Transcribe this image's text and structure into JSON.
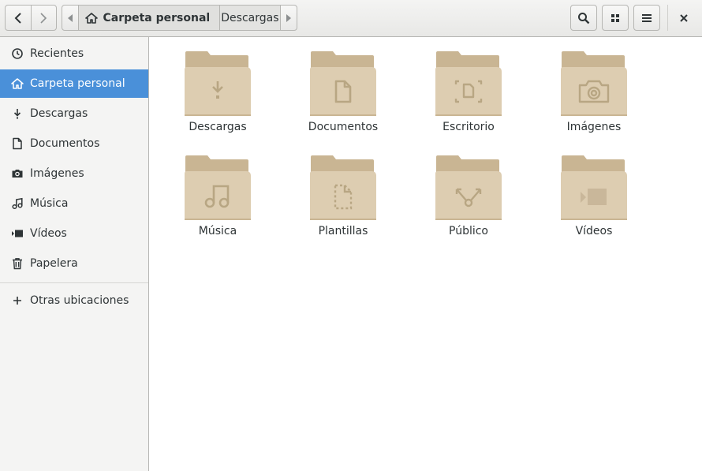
{
  "header": {
    "back_icon": "go-previous-icon",
    "forward_icon": "go-next-icon",
    "path": {
      "home_icon": "home-icon",
      "current": "Carpeta personal",
      "child": "Descargas"
    },
    "search_icon": "search-icon",
    "grid_view_icon": "view-grid-icon",
    "menu_icon": "open-menu-icon",
    "close_icon": "close-icon"
  },
  "sidebar": {
    "items": [
      {
        "label": "Recientes",
        "icon": "clock-icon"
      },
      {
        "label": "Carpeta personal",
        "icon": "home-icon",
        "selected": true
      },
      {
        "label": "Descargas",
        "icon": "download-icon"
      },
      {
        "label": "Documentos",
        "icon": "document-icon"
      },
      {
        "label": "Imágenes",
        "icon": "camera-icon"
      },
      {
        "label": "Música",
        "icon": "music-icon"
      },
      {
        "label": "Vídeos",
        "icon": "video-icon"
      },
      {
        "label": "Papelera",
        "icon": "trash-icon"
      }
    ],
    "other": {
      "label": "Otras ubicaciones",
      "icon": "plus-icon"
    }
  },
  "folders": [
    {
      "label": "Descargas",
      "emblem": "download-icon"
    },
    {
      "label": "Documentos",
      "emblem": "document-icon"
    },
    {
      "label": "Escritorio",
      "emblem": "desktop-icon"
    },
    {
      "label": "Imágenes",
      "emblem": "camera-icon"
    },
    {
      "label": "Música",
      "emblem": "music-icon"
    },
    {
      "label": "Plantillas",
      "emblem": "template-icon"
    },
    {
      "label": "Público",
      "emblem": "share-icon"
    },
    {
      "label": "Vídeos",
      "emblem": "video-icon"
    }
  ],
  "colors": {
    "selection": "#4a90d9",
    "folder_body": "#ddcdb1",
    "folder_back": "#c9b593",
    "folder_emblem": "#b8a683"
  }
}
